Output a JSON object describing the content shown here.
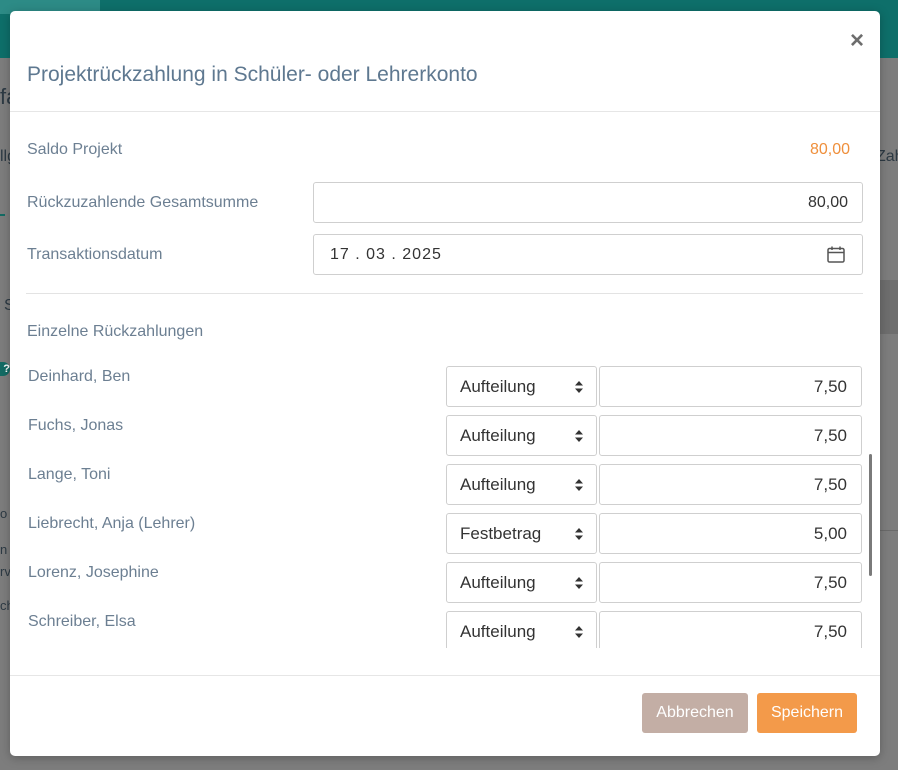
{
  "background": {
    "fragments": [
      "fa",
      "llg",
      "Zah",
      "S",
      "n",
      "rv",
      "ch",
      "o"
    ]
  },
  "modal": {
    "title": "Projektrückzahlung in Schüler- oder Lehrerkonto",
    "close_label": "×",
    "saldo_label": "Saldo Projekt",
    "saldo_value": "80,00",
    "total_label": "Rückzuzahlende Gesamtsumme",
    "total_value": "80,00",
    "date_label": "Transaktionsdatum",
    "date_value": "17 . 03 . 2025",
    "section_title": "Einzelne Rückzahlungen",
    "rows": [
      {
        "name": "Deinhard, Ben",
        "type": "Aufteilung",
        "amount": "7,50"
      },
      {
        "name": "Fuchs, Jonas",
        "type": "Aufteilung",
        "amount": "7,50"
      },
      {
        "name": "Lange, Toni",
        "type": "Aufteilung",
        "amount": "7,50"
      },
      {
        "name": "Liebrecht, Anja (Lehrer)",
        "type": "Festbetrag",
        "amount": "5,00"
      },
      {
        "name": "Lorenz, Josephine",
        "type": "Aufteilung",
        "amount": "7,50"
      },
      {
        "name": "Schreiber, Elsa",
        "type": "Aufteilung",
        "amount": "7,50"
      }
    ],
    "cancel_label": "Abbrechen",
    "save_label": "Speichern"
  },
  "colors": {
    "primary_teal": "#0e6f6a",
    "accent_orange": "#f39a4a",
    "saldo_orange": "#ef8f3b",
    "cancel_button": "#c3aea5",
    "label_text": "#6c7f92"
  }
}
